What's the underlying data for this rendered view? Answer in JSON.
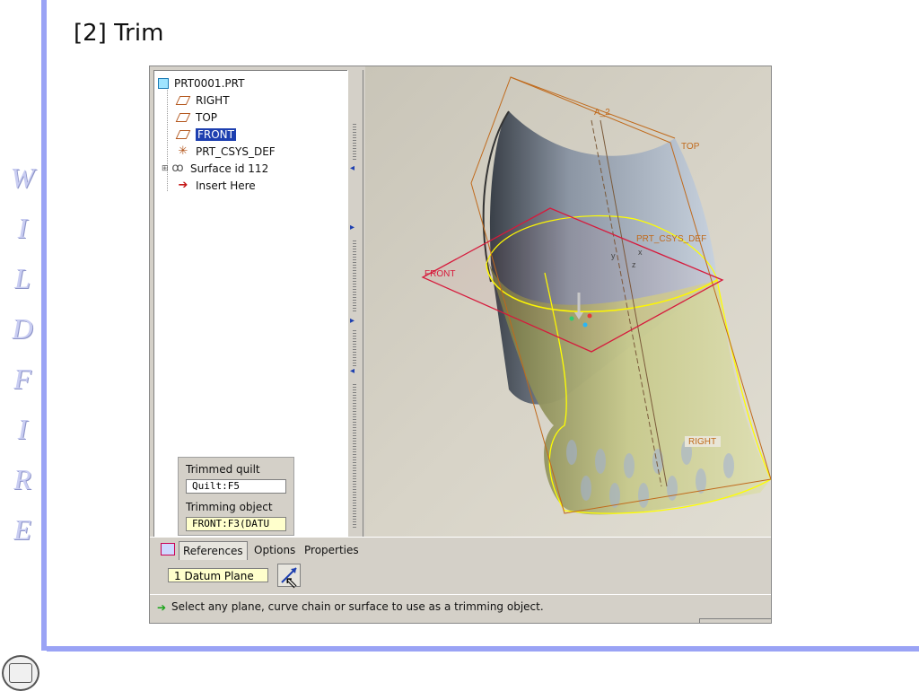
{
  "slide": {
    "title": "[2] Trim",
    "side_word": [
      "W",
      "I",
      "L",
      "D",
      "F",
      "I",
      "R",
      "E"
    ]
  },
  "model_tree": {
    "items": [
      {
        "label": "PRT0001.PRT",
        "icon": "part-icon",
        "selected": false
      },
      {
        "label": "RIGHT",
        "icon": "datum-plane-icon",
        "selected": false
      },
      {
        "label": "TOP",
        "icon": "datum-plane-icon",
        "selected": false
      },
      {
        "label": "FRONT",
        "icon": "datum-plane-icon",
        "selected": true
      },
      {
        "label": "PRT_CSYS_DEF",
        "icon": "csys-icon",
        "selected": false
      },
      {
        "label": "Surface id 112",
        "icon": "surface-icon",
        "selected": false
      },
      {
        "label": "Insert Here",
        "icon": "insert-arrow-icon",
        "selected": false
      }
    ]
  },
  "popup": {
    "trimmed_label": "Trimmed quilt",
    "trimmed_value": "Quilt:F5",
    "trimming_label": "Trimming object",
    "trimming_value": "FRONT:F3(DATU"
  },
  "viewport": {
    "labels": {
      "a2": "A_2",
      "top": "TOP",
      "csys": "PRT_CSYS_DEF",
      "front": "FRONT",
      "right": "RIGHT",
      "y": "y",
      "x": "x",
      "z": "z"
    },
    "colors": {
      "datum": "#c06a1c",
      "front_plane": "#d61a3c",
      "quilt_edge": "#ffff00"
    }
  },
  "tabs": {
    "references": "References",
    "options": "Options",
    "properties": "Properties"
  },
  "controls": {
    "reference_field": "1 Datum Plane"
  },
  "status": {
    "message": "Select any plane, curve chain or surface to use as a trimming object."
  }
}
